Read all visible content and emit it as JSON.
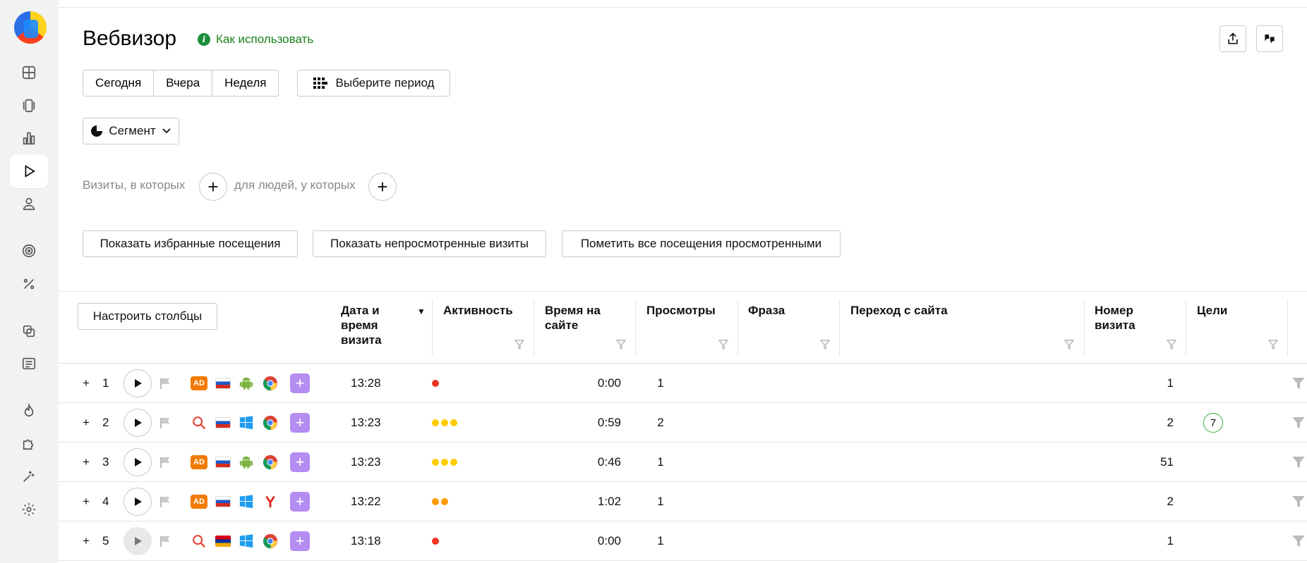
{
  "page": {
    "title": "Вебвизор",
    "howto_label": "Как использовать",
    "share_icon": "share-icon",
    "feedback_icon": "feedback-icon"
  },
  "period": {
    "today": "Сегодня",
    "yesterday": "Вчера",
    "week": "Неделя",
    "choose_period": "Выберите период"
  },
  "segment": {
    "label": "Сегмент"
  },
  "filters": {
    "visits_where": "Визиты, в которых",
    "people_where": "для людей, у которых"
  },
  "actions": {
    "show_favorites": "Показать избранные посещения",
    "show_unviewed": "Показать непросмотренные визиты",
    "mark_all_viewed": "Пометить все посещения просмотренными"
  },
  "table": {
    "configure_columns": "Настроить столбцы",
    "sort_indicator": "▼",
    "headers": {
      "datetime_l1": "Дата и",
      "datetime_l2": "время",
      "datetime_l3": "визита",
      "activity": "Активность",
      "time_l1": "Время на",
      "time_l2": "сайте",
      "views": "Просмотры",
      "phrase": "Фраза",
      "referrer": "Переход с сайта",
      "visit_l1": "Номер",
      "visit_l2": "визита",
      "goals": "Цели"
    },
    "rows": [
      {
        "n": "1",
        "time": "13:28",
        "duration": "0:00",
        "views": "1",
        "visit_no": "1",
        "goals": "",
        "source": "ad",
        "country": "ru",
        "os": "android",
        "browser": "chrome",
        "activity": 1,
        "activity_color": "#ee3322",
        "play_state": "normal"
      },
      {
        "n": "2",
        "time": "13:23",
        "duration": "0:59",
        "views": "2",
        "visit_no": "2",
        "goals": "7",
        "source": "search",
        "country": "ru",
        "os": "windows",
        "browser": "chrome",
        "activity": 3,
        "activity_color": "#ffcc00",
        "play_state": "normal"
      },
      {
        "n": "3",
        "time": "13:23",
        "duration": "0:46",
        "views": "1",
        "visit_no": "51",
        "goals": "",
        "source": "ad",
        "country": "ru",
        "os": "android",
        "browser": "chrome",
        "activity": 3,
        "activity_color": "#ffcc00",
        "play_state": "normal"
      },
      {
        "n": "4",
        "time": "13:22",
        "duration": "1:02",
        "views": "1",
        "visit_no": "2",
        "goals": "",
        "source": "ad",
        "country": "ru",
        "os": "windows",
        "browser": "yandex",
        "activity": 2,
        "activity_color": "#ff9900",
        "play_state": "normal"
      },
      {
        "n": "5",
        "time": "13:18",
        "duration": "0:00",
        "views": "1",
        "visit_no": "1",
        "goals": "",
        "source": "search",
        "country": "am",
        "os": "windows",
        "browser": "chrome",
        "activity": 1,
        "activity_color": "#ee3322",
        "play_state": "grey"
      }
    ]
  }
}
